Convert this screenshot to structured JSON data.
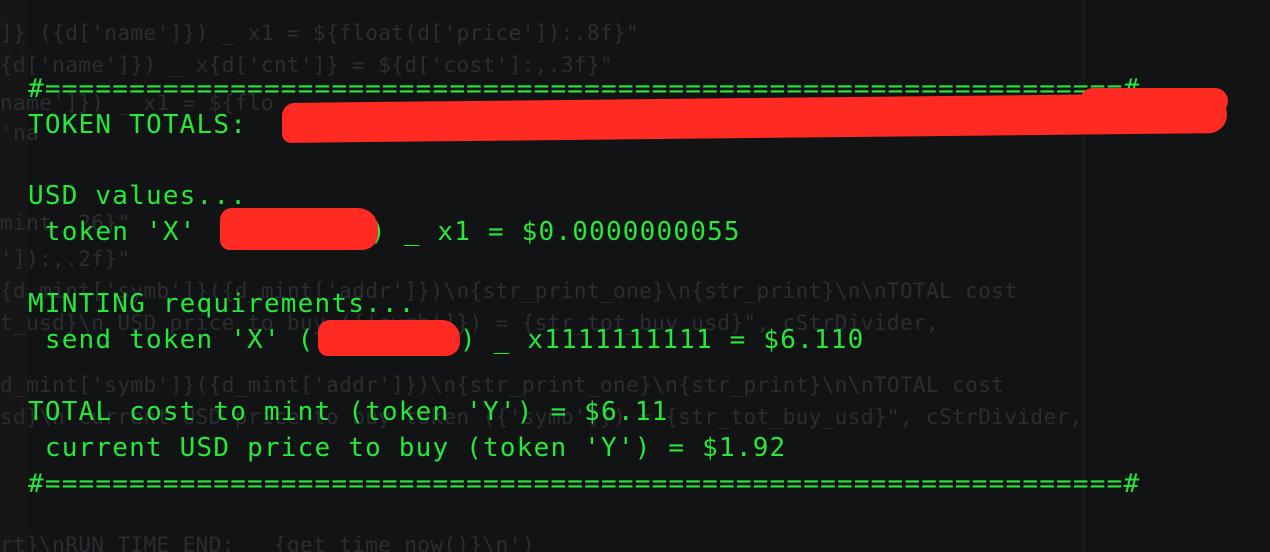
{
  "background_code": [
    "]} ({d['name']}) _ x1 = ${float(d['price']):.8f}\"",
    "{d['name']}) _ x{d['cnt']} = ${d['cost']:,.3f}\"",
    "name']}) _ x1 = ${flo",
    "'na",
    "mint  26}\"",
    "']):,.2f}\"",
    "{d_mint['symb']}({d_mint['addr']})\\n{str_print_one}\\n{str_print}\\n\\nTOTAL cost",
    "t_usd}\\n USD price to buy ({'symb']}) = {str_tot_buy_usd}\", cStrDivider,",
    "d_mint['symb']}({d_mint['addr']})\\n{str_print_one}\\n{str_print}\\n\\nTOTAL cost",
    "sd}\\n current USD price to buy token ({'symb']}) = {str_tot_buy_usd}\", cStrDivider,",
    "rt}\\nRUN TIME END:   {get_time_now()}\\n')"
  ],
  "terminal": {
    "divider_top": "#================================================================#",
    "token_totals_label": "TOKEN TOTALS:",
    "usd_values_header": "USD values...",
    "usd_token_line_prefix": " token 'X' ",
    "usd_token_line_suffix": ") _ x1 = $0.0000000055",
    "minting_header": "MINTING requirements...",
    "send_line_prefix": " send token 'X' (",
    "send_line_suffix": ") _ x1111111111 = $6.110",
    "total_cost_line": "TOTAL cost to mint (token 'Y') = $6.11",
    "current_price_line": " current USD price to buy (token 'Y') = $1.92",
    "divider_bottom": "#================================================================#"
  },
  "colors": {
    "terminal_text": "#27e83a",
    "redaction": "#ff2a22",
    "background": "#121315"
  }
}
